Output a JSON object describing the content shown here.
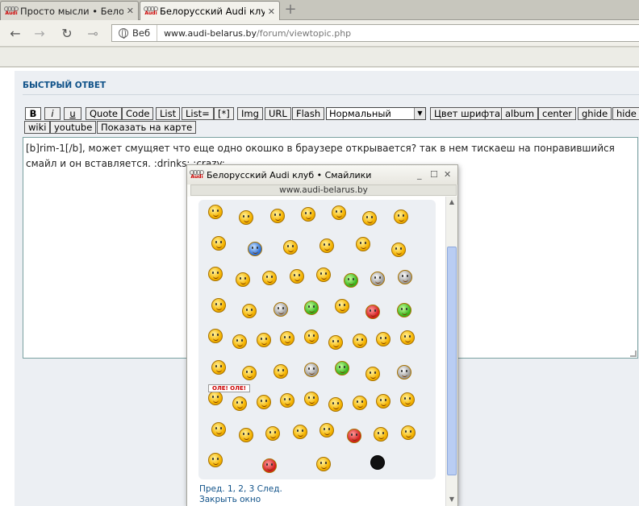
{
  "tabs": [
    {
      "title": "Просто мысли • Белору...",
      "close": "✕",
      "brand": "Audi"
    },
    {
      "title": "Белорусский Audi клуб ...",
      "close": "✕",
      "brand": "Audi"
    }
  ],
  "newtab": "+",
  "nav": {
    "back": "←",
    "forward": "→",
    "reload": "↻",
    "key": "⊸",
    "web_label": "Веб",
    "url_domain": "www.audi-belarus.by",
    "url_path": "/forum/viewtopic.php"
  },
  "reply": {
    "heading": "БЫСТРЫЙ ОТВЕТ",
    "toolbar": [
      "B",
      "i",
      "u",
      "Quote",
      "Code",
      "List",
      "List=",
      "[*]",
      "Img",
      "URL",
      "Flash"
    ],
    "font_size_select": "Нормальный",
    "toolbar2": [
      "Цвет шрифта",
      "album",
      "center",
      "ghide",
      "hide"
    ],
    "toolbar3": [
      "wiki",
      "youtube",
      "Показать на карте"
    ],
    "message": "[b]rim-1[/b],  может смущяет что еще одно окошко в браузере открывается? так в нем тискаеш на понравившийся смайл и он вставляется. :drinks:  :crazy:"
  },
  "popup": {
    "title": "Белорусский Audi клуб • Смайлики",
    "minimize": "_",
    "maximize": "☐",
    "close": "✕",
    "domain": "www.audi-belarus.by",
    "pagination": "Пред.  1, 2, 3  След.",
    "close_link": "Закрыть окно",
    "smiley_rows": [
      [
        "yellow",
        "yellow",
        "yellow",
        "yellow",
        "yellow",
        "yellow",
        "yellow"
      ],
      [
        "yellow",
        "blue",
        "yellow",
        "yellow",
        "yellow",
        "yellow"
      ],
      [
        "yellow",
        "yellow",
        "yellow",
        "yellow",
        "yellow",
        "green",
        "gray",
        "gray"
      ],
      [
        "yellow",
        "yellow",
        "gray",
        "green",
        "yellow",
        "red",
        "green"
      ],
      [
        "yellow",
        "yellow",
        "yellow",
        "yellow",
        "yellow",
        "yellow",
        "yellow",
        "yellow",
        "yellow"
      ],
      [
        "yellow",
        "yellow",
        "yellow",
        "gray",
        "green",
        "yellow",
        "gray"
      ],
      [
        "yellow",
        "yellow",
        "yellow",
        "yellow",
        "yellow",
        "yellow",
        "yellow",
        "yellow",
        "yellow"
      ],
      [
        "yellow",
        "yellow",
        "yellow",
        "yellow",
        "yellow",
        "red",
        "yellow",
        "yellow"
      ],
      [
        "yellow",
        "red",
        "yellow",
        "black"
      ]
    ],
    "ole_label": "ОЛЕ! ОЛЕ!"
  }
}
